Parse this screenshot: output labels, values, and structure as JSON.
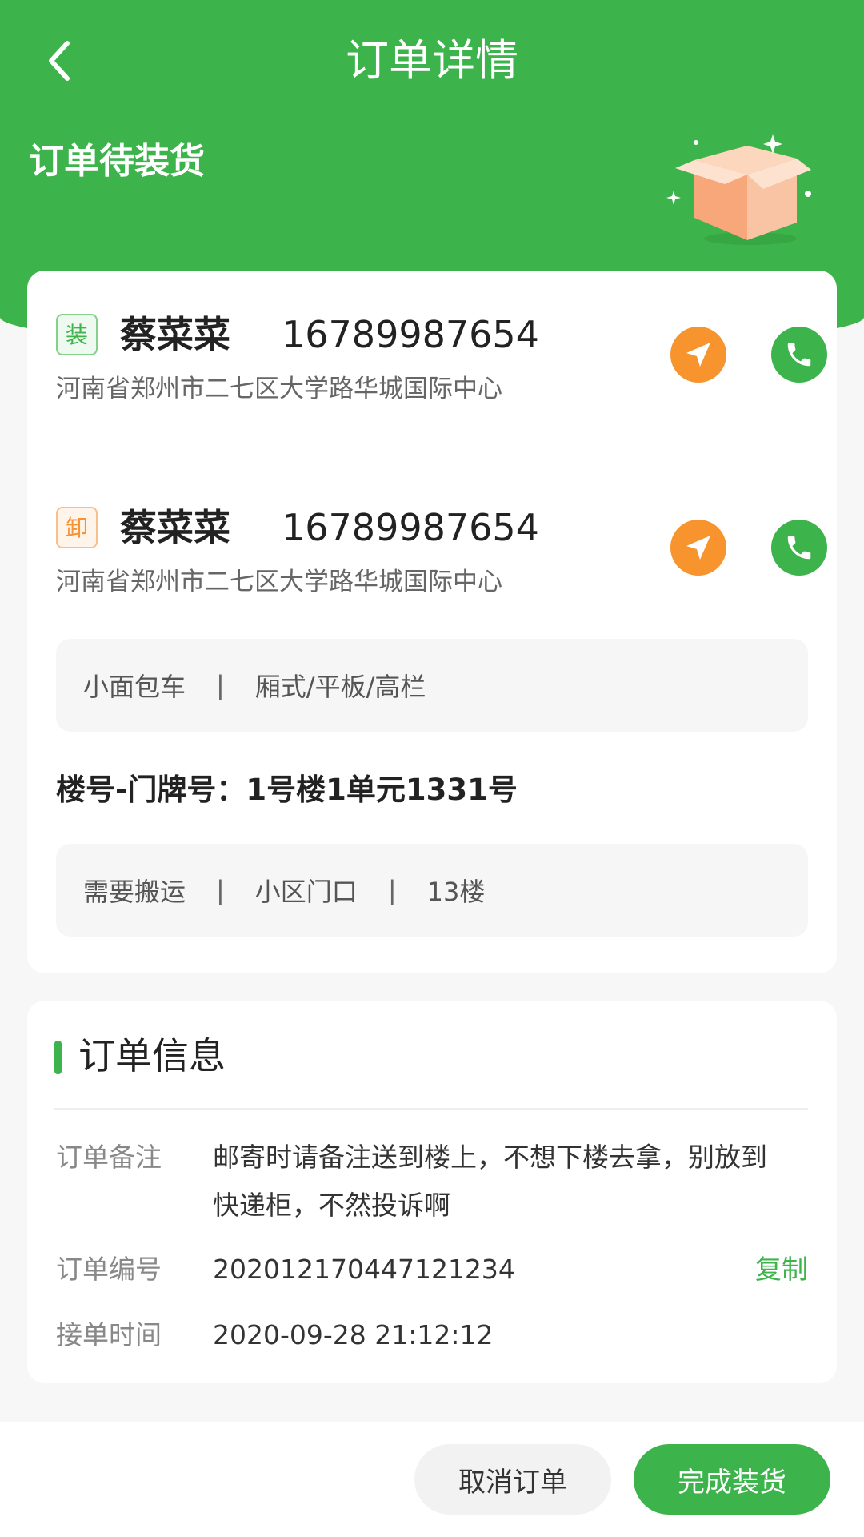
{
  "header": {
    "title": "订单详情",
    "status": "订单待装货"
  },
  "colors": {
    "primary": "#3cb44b",
    "navigate": "#f7942e",
    "background": "#f7f7f7"
  },
  "stops": [
    {
      "tag": "装",
      "name": "蔡菜菜",
      "phone": "16789987654",
      "address": "河南省郑州市二七区大学路华城国际中心",
      "nav_icon": "navigate-icon",
      "call_icon": "phone-icon"
    },
    {
      "tag": "卸",
      "name": "蔡菜菜",
      "phone": "16789987654",
      "address": "河南省郑州市二七区大学路华城国际中心",
      "nav_icon": "navigate-icon",
      "call_icon": "phone-icon"
    }
  ],
  "vehicle": {
    "type": "小面包车",
    "separator": "|",
    "body": "厢式/平板/高栏"
  },
  "floor": {
    "label": "楼号-门牌号：",
    "value": "1号楼1单元1331号"
  },
  "handling": {
    "items": [
      "需要搬运",
      "小区门口",
      "13楼"
    ],
    "separator": "|"
  },
  "order_info": {
    "title": "订单信息",
    "remark_label": "订单备注",
    "remark_line1": "邮寄时请备注送到楼上，不想下楼去拿，别放到",
    "remark_line2": "快递柜，不然投诉啊",
    "number_label": "订单编号",
    "number": "202012170447121234",
    "copy_label": "复制",
    "time_label": "接单时间",
    "time": "2020-09-28 21:12:12"
  },
  "actions": {
    "cancel_label": "取消订单",
    "done_label": "完成装货"
  }
}
